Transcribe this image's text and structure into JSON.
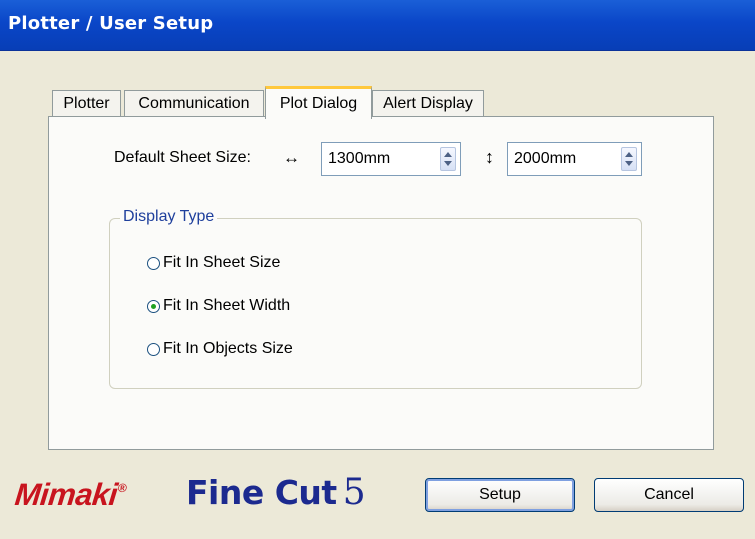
{
  "window": {
    "title": "Plotter / User Setup"
  },
  "tabs": [
    {
      "label": "Plotter"
    },
    {
      "label": "Communication"
    },
    {
      "label": "Plot Dialog"
    },
    {
      "label": "Alert Display"
    }
  ],
  "active_tab": "Plot Dialog",
  "sheet": {
    "label": "Default Sheet Size:",
    "width_icon": "↔",
    "width_value": "1300mm",
    "height_icon": "↕",
    "height_value": "2000mm"
  },
  "display_type": {
    "legend": "Display Type",
    "options": [
      {
        "label": "Fit In Sheet Size",
        "checked": false
      },
      {
        "label": "Fit In Sheet Width",
        "checked": true
      },
      {
        "label": "Fit In Objects Size",
        "checked": false
      }
    ]
  },
  "footer": {
    "brand": "Mimaki",
    "brand_mark": "®",
    "product": "Fine Cut",
    "product_version": "5",
    "setup_label": "Setup",
    "cancel_label": "Cancel"
  },
  "colors": {
    "titlebar": "#0a46c8",
    "brand_red": "#c8141e",
    "product_blue": "#1c2a8f",
    "active_tab_highlight": "#ffc83c",
    "legend_text": "#1e3f9c",
    "radio_checked": "#21a121"
  }
}
